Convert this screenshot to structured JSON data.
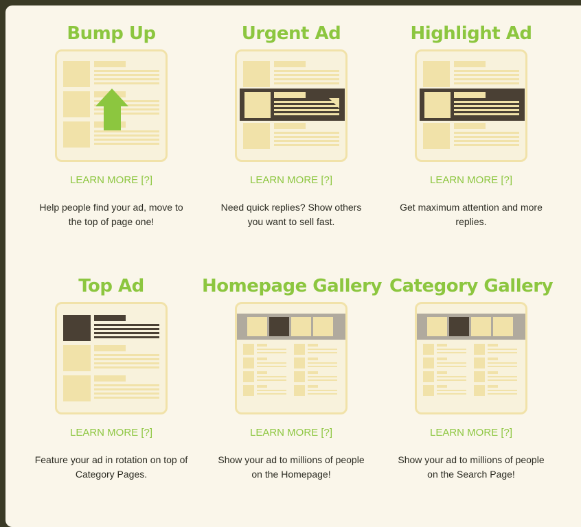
{
  "features": [
    {
      "title": "Bump Up",
      "learn": "LEARN MORE [?]",
      "desc": "Help people find your ad, move to the top of page one!"
    },
    {
      "title": "Urgent Ad",
      "learn": "LEARN MORE [?]",
      "desc": "Need quick replies? Show others you want to sell fast."
    },
    {
      "title": "Highlight Ad",
      "learn": "LEARN MORE [?]",
      "desc": "Get maximum attention and more replies."
    },
    {
      "title": "Top Ad",
      "learn": "LEARN MORE [?]",
      "desc": "Feature your ad in rotation on top of Category Pages."
    },
    {
      "title": "Homepage Gallery",
      "learn": "LEARN MORE [?]",
      "desc": "Show your ad to millions of people on the Homepage!"
    },
    {
      "title": "Category Gallery",
      "learn": "LEARN MORE [?]",
      "desc": "Show your ad to millions of people on the Search Page!"
    }
  ],
  "colors": {
    "accent": "#8cc63f",
    "dark": "#4a4034",
    "block": "#f1e2a9",
    "gallery_bar": "#b0aa9e"
  },
  "icons": [
    "bump-up-arrow-icon",
    "urgent-ad-icon",
    "highlight-ad-icon",
    "top-ad-icon",
    "homepage-gallery-icon",
    "category-gallery-icon"
  ]
}
